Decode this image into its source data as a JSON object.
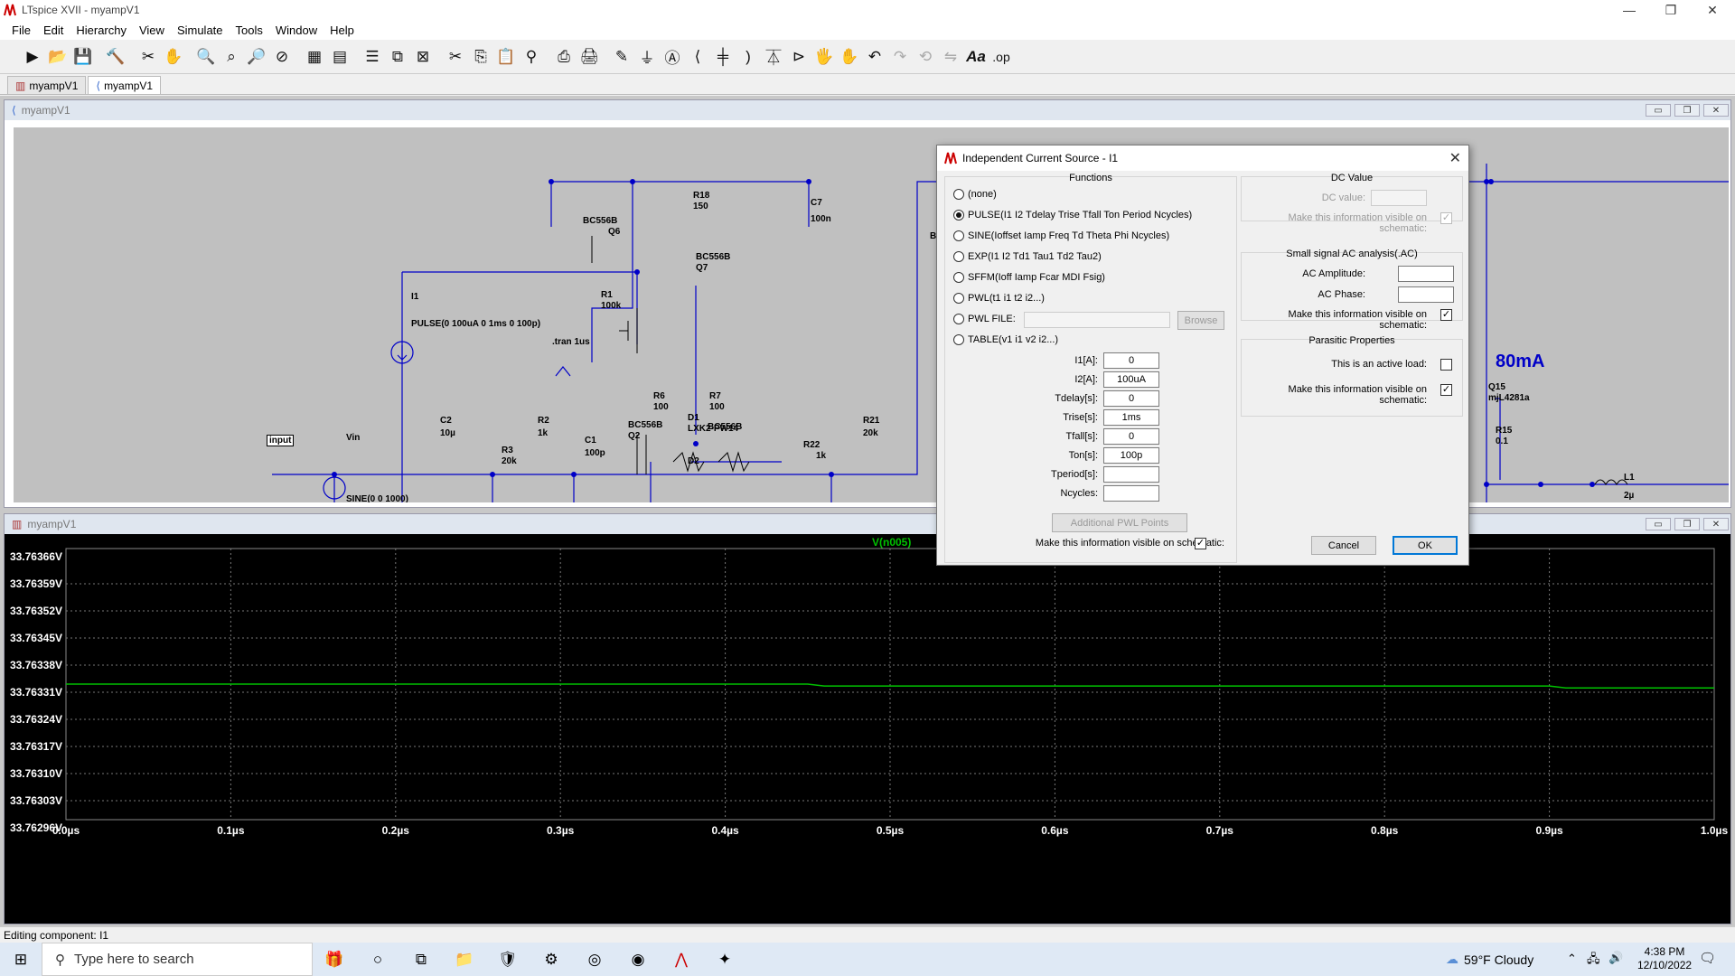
{
  "window": {
    "title": "LTspice XVII - myampV1"
  },
  "menu": [
    "File",
    "Edit",
    "Hierarchy",
    "View",
    "Simulate",
    "Tools",
    "Window",
    "Help"
  ],
  "toolbar_icons": [
    "run-icon",
    "open-icon",
    "save-icon",
    "control-panel-icon",
    "halt-icon",
    "pan-icon",
    "zoom-in-icon",
    "zoom-box-icon",
    "zoom-out-icon",
    "zoom-fit-icon",
    "waveform-icon",
    "autorange-icon",
    "tile-icon",
    "cascade-icon",
    "close-all-icon",
    "cut-icon",
    "copy-icon",
    "paste-icon",
    "find-icon",
    "print-icon",
    "print-preview-icon",
    "wire-icon",
    "ground-icon",
    "label-icon",
    "resistor-icon",
    "capacitor-icon",
    "inductor-icon",
    "diode-icon",
    "component-icon",
    "move-icon",
    "drag-icon",
    "undo-icon",
    "redo-icon",
    "rotate-icon",
    "mirror-icon",
    "text-icon",
    "spice-directive-icon"
  ],
  "tabs": [
    "myampV1",
    "myampV1"
  ],
  "schematic": {
    "title": "myampV1",
    "labels": {
      "q6_type": "BC556B",
      "q6": "Q6",
      "r18": "R18",
      "r18_val": "150",
      "c7": "C7",
      "c7_val": "100n",
      "q7_type": "BC556B",
      "q7": "Q7",
      "r1": "R1",
      "r1_val": "100k",
      "i1": "I1",
      "i1_val": "PULSE(0 100uA 0 1ms 0 100p)",
      "tran": ".tran 1us",
      "r6": "R6",
      "r6_val": "100",
      "r7": "R7",
      "r7_val": "100",
      "input": "input",
      "vin": "Vin",
      "c2": "C2",
      "c2_val": "10µ",
      "r3": "R3",
      "r3_val": "20k",
      "r2": "R2",
      "r2_val": "1k",
      "c1": "C1",
      "c1_val": "100p",
      "q2_type": "BC556B",
      "q2": "Q2",
      "d1": "D1",
      "d1_val": "LXK2-PW14",
      "q3_type": "BC556B",
      "d2": "D2",
      "r22": "R22",
      "r22_val": "1k",
      "r21": "R21",
      "r21_val": "20k",
      "vin_val": "SINE(0 0 1000)",
      "bc_partial": "BC",
      "current_label": "80mA",
      "q15": "Q15",
      "q15_type": "mjL4281a",
      "r15": "R15",
      "r15_val": "0.1",
      "l1": "L1",
      "l1_val": "2µ"
    }
  },
  "waveform": {
    "title": "myampV1",
    "trace_name": "V(n005)"
  },
  "chart_data": {
    "type": "line",
    "title": "V(n005)",
    "xlabel": "",
    "ylabel": "",
    "x_ticks": [
      "0.0µs",
      "0.1µs",
      "0.2µs",
      "0.3µs",
      "0.4µs",
      "0.5µs",
      "0.6µs",
      "0.7µs",
      "0.8µs",
      "0.9µs",
      "1.0µs"
    ],
    "y_ticks": [
      "33.76366V",
      "33.76359V",
      "33.76352V",
      "33.76345V",
      "33.76338V",
      "33.76331V",
      "33.76324V",
      "33.76317V",
      "33.76310V",
      "33.76303V",
      "33.76296V"
    ],
    "xlim": [
      0,
      1.0
    ],
    "ylim": [
      33.76296,
      33.76366
    ],
    "grid": true,
    "series": [
      {
        "name": "V(n005)",
        "color": "#00c000",
        "x": [
          0,
          0.45,
          0.46,
          0.9,
          0.91,
          1.0
        ],
        "y": [
          33.76331,
          33.76331,
          33.763305,
          33.763305,
          33.7633,
          33.7633
        ]
      }
    ]
  },
  "dialog": {
    "title": "Independent Current Source - I1",
    "functions_title": "Functions",
    "functions": [
      "(none)",
      "PULSE(I1 I2 Tdelay Trise Tfall Ton Period Ncycles)",
      "SINE(Ioffset Iamp Freq Td Theta Phi Ncycles)",
      "EXP(I1 I2 Td1 Tau1 Td2 Tau2)",
      "SFFM(Ioff Iamp Fcar MDI Fsig)",
      "PWL(t1 i1 t2 i2...)",
      "PWL FILE:",
      "TABLE(v1 i1 v2 i2...)"
    ],
    "selected_function": "PULSE(I1 I2 Tdelay Trise Tfall Ton Period Ncycles)",
    "browse": "Browse",
    "params": [
      {
        "label": "I1[A]:",
        "value": "0"
      },
      {
        "label": "I2[A]:",
        "value": "100uA"
      },
      {
        "label": "Tdelay[s]:",
        "value": "0"
      },
      {
        "label": "Trise[s]:",
        "value": "1ms"
      },
      {
        "label": "Tfall[s]:",
        "value": "0"
      },
      {
        "label": "Ton[s]:",
        "value": "100p"
      },
      {
        "label": "Tperiod[s]:",
        "value": ""
      },
      {
        "label": "Ncycles:",
        "value": ""
      }
    ],
    "additional_pwl": "Additional PWL Points",
    "visible_label": "Make this information visible on schematic:",
    "dc_title": "DC Value",
    "dc_value_label": "DC value:",
    "ac_title": "Small signal AC analysis(.AC)",
    "ac_amp_label": "AC Amplitude:",
    "ac_phase_label": "AC Phase:",
    "parasitic_title": "Parasitic Properties",
    "active_load_label": "This is an active load:",
    "cancel": "Cancel",
    "ok": "OK"
  },
  "status": {
    "text": "Editing component: I1"
  },
  "taskbar": {
    "search_placeholder": "Type here to search",
    "weather": "59°F  Cloudy",
    "time": "4:38 PM",
    "date": "12/10/2022"
  }
}
